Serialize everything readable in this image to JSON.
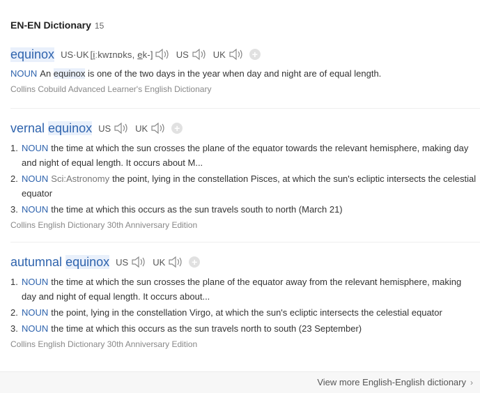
{
  "header": {
    "title": "EN-EN Dictionary",
    "count": "15"
  },
  "entries": [
    {
      "word": "equinox",
      "pron_us_uk_label": "US·UK",
      "ipa_pre": "[",
      "ipa_u1": "i",
      "ipa_mid": "ːkwɪnɒks, ",
      "ipa_u2": "e",
      "ipa_post": "k-]",
      "us_label": "US",
      "uk_label": "UK",
      "add_icon": "+",
      "pos": "NOUN",
      "def_pre": "An ",
      "def_hl": "equinox",
      "def_post": " is one of the two days in the year when day and night are of equal length.",
      "source": "Collins Cobuild Advanced Learner's English Dictionary"
    },
    {
      "word_pre": "vernal ",
      "word_hl": "equinox",
      "us_label": "US",
      "uk_label": "UK",
      "add_icon": "+",
      "defs": [
        {
          "num": "1.",
          "pos": "NOUN",
          "subject": "",
          "text": "the time at which the sun crosses the plane of the equator towards the relevant hemisphere, making day and night of equal length. It occurs about M..."
        },
        {
          "num": "2.",
          "pos": "NOUN",
          "subject": "Sci:Astronomy",
          "text": "the point, lying in the constellation Pisces, at which the sun's ecliptic intersects the celestial equator"
        },
        {
          "num": "3.",
          "pos": "NOUN",
          "subject": "",
          "text": "the time at which this occurs as the sun travels south to north (March 21)"
        }
      ],
      "source": "Collins English Dictionary 30th Anniversary Edition"
    },
    {
      "word_pre": "autumnal ",
      "word_hl": "equinox",
      "us_label": "US",
      "uk_label": "UK",
      "add_icon": "+",
      "defs": [
        {
          "num": "1.",
          "pos": "NOUN",
          "subject": "",
          "text": "the time at which the sun crosses the plane of the equator away from the relevant hemisphere, making day and night of equal length. It occurs about..."
        },
        {
          "num": "2.",
          "pos": "NOUN",
          "subject": "",
          "text": "the point, lying in the constellation Virgo, at which the sun's ecliptic intersects the celestial equator"
        },
        {
          "num": "3.",
          "pos": "NOUN",
          "subject": "",
          "text": "the time at which this occurs as the sun travels north to south (23 September)"
        }
      ],
      "source": "Collins English Dictionary 30th Anniversary Edition"
    }
  ],
  "footer": {
    "more_link": "View more English-English dictionary",
    "chevron": "›"
  },
  "icons": {
    "speaker": "speaker-icon",
    "add": "plus-circle-icon",
    "chevron": "chevron-right-icon"
  },
  "colors": {
    "accent": "#2e63ad",
    "highlight": "#e9f0fb",
    "muted": "#888888"
  }
}
